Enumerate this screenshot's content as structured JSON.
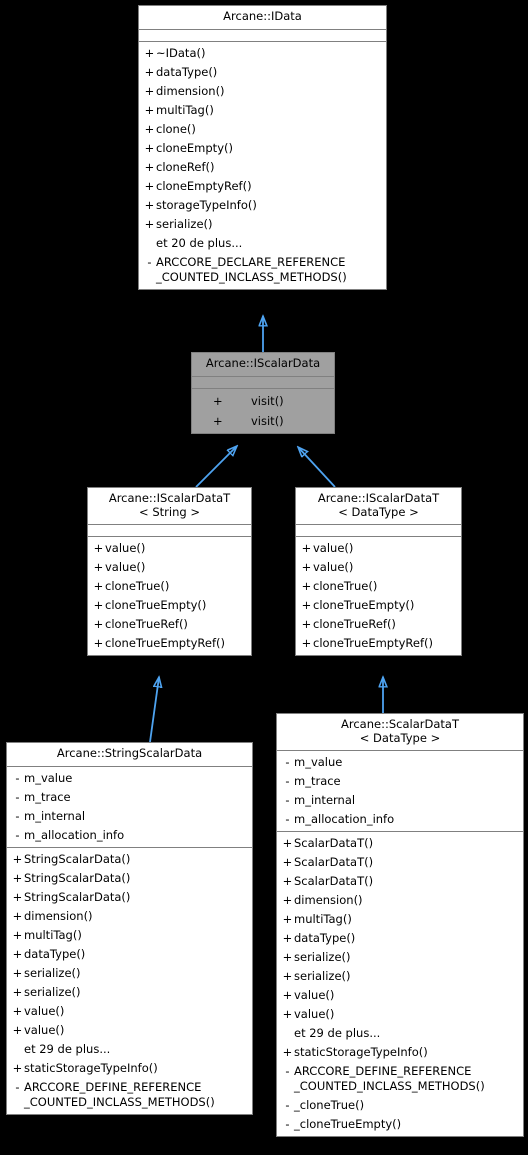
{
  "diagram": {
    "type": "uml-class-inheritance",
    "background_color": "#000000",
    "box_fill": "#ffffff",
    "box_border": "#808080",
    "highlight_fill": "#a0a0a0",
    "edge_color": "#4ea3f0",
    "more_label_20": "et 20 de plus...",
    "more_label_29": "et 29 de plus..."
  },
  "nodes": {
    "idata": {
      "title": "Arcane::IData",
      "attributes": [],
      "methods": [
        {
          "vis": "+",
          "name": "~IData()"
        },
        {
          "vis": "+",
          "name": "dataType()"
        },
        {
          "vis": "+",
          "name": "dimension()"
        },
        {
          "vis": "+",
          "name": "multiTag()"
        },
        {
          "vis": "+",
          "name": "clone()"
        },
        {
          "vis": "+",
          "name": "cloneEmpty()"
        },
        {
          "vis": "+",
          "name": "cloneRef()"
        },
        {
          "vis": "+",
          "name": "cloneEmptyRef()"
        },
        {
          "vis": "+",
          "name": "storageTypeInfo()"
        },
        {
          "vis": "+",
          "name": "serialize()"
        },
        {
          "vis": "",
          "name": "et 20 de plus..."
        },
        {
          "vis": "-",
          "name": "ARCCORE_DECLARE_REFERENCE\n_COUNTED_INCLASS_METHODS()"
        }
      ]
    },
    "iscalardata": {
      "title": "Arcane::IScalarData",
      "attributes": [],
      "methods": [
        {
          "vis": "+",
          "name": "visit()"
        },
        {
          "vis": "+",
          "name": "visit()"
        }
      ]
    },
    "iscalardatat_string": {
      "title": "Arcane::IScalarDataT\n< String >",
      "attributes": [],
      "methods": [
        {
          "vis": "+",
          "name": "value()"
        },
        {
          "vis": "+",
          "name": "value()"
        },
        {
          "vis": "+",
          "name": "cloneTrue()"
        },
        {
          "vis": "+",
          "name": "cloneTrueEmpty()"
        },
        {
          "vis": "+",
          "name": "cloneTrueRef()"
        },
        {
          "vis": "+",
          "name": "cloneTrueEmptyRef()"
        }
      ]
    },
    "iscalardatat_datatype": {
      "title": "Arcane::IScalarDataT\n< DataType >",
      "attributes": [],
      "methods": [
        {
          "vis": "+",
          "name": "value()"
        },
        {
          "vis": "+",
          "name": "value()"
        },
        {
          "vis": "+",
          "name": "cloneTrue()"
        },
        {
          "vis": "+",
          "name": "cloneTrueEmpty()"
        },
        {
          "vis": "+",
          "name": "cloneTrueRef()"
        },
        {
          "vis": "+",
          "name": "cloneTrueEmptyRef()"
        }
      ]
    },
    "stringscalardata": {
      "title": "Arcane::StringScalarData",
      "attributes": [
        {
          "vis": "-",
          "name": "m_value"
        },
        {
          "vis": "-",
          "name": "m_trace"
        },
        {
          "vis": "-",
          "name": "m_internal"
        },
        {
          "vis": "-",
          "name": "m_allocation_info"
        }
      ],
      "methods": [
        {
          "vis": "+",
          "name": "StringScalarData()"
        },
        {
          "vis": "+",
          "name": "StringScalarData()"
        },
        {
          "vis": "+",
          "name": "StringScalarData()"
        },
        {
          "vis": "+",
          "name": "dimension()"
        },
        {
          "vis": "+",
          "name": "multiTag()"
        },
        {
          "vis": "+",
          "name": "dataType()"
        },
        {
          "vis": "+",
          "name": "serialize()"
        },
        {
          "vis": "+",
          "name": "serialize()"
        },
        {
          "vis": "+",
          "name": "value()"
        },
        {
          "vis": "+",
          "name": "value()"
        },
        {
          "vis": "",
          "name": "et 29 de plus..."
        },
        {
          "vis": "+",
          "name": "staticStorageTypeInfo()"
        },
        {
          "vis": "-",
          "name": "ARCCORE_DEFINE_REFERENCE\n_COUNTED_INCLASS_METHODS()"
        }
      ]
    },
    "scalardatat": {
      "title": "Arcane::ScalarDataT\n< DataType >",
      "attributes": [
        {
          "vis": "-",
          "name": "m_value"
        },
        {
          "vis": "-",
          "name": "m_trace"
        },
        {
          "vis": "-",
          "name": "m_internal"
        },
        {
          "vis": "-",
          "name": "m_allocation_info"
        }
      ],
      "methods": [
        {
          "vis": "+",
          "name": "ScalarDataT()"
        },
        {
          "vis": "+",
          "name": "ScalarDataT()"
        },
        {
          "vis": "+",
          "name": "ScalarDataT()"
        },
        {
          "vis": "+",
          "name": "dimension()"
        },
        {
          "vis": "+",
          "name": "multiTag()"
        },
        {
          "vis": "+",
          "name": "dataType()"
        },
        {
          "vis": "+",
          "name": "serialize()"
        },
        {
          "vis": "+",
          "name": "serialize()"
        },
        {
          "vis": "+",
          "name": "value()"
        },
        {
          "vis": "+",
          "name": "value()"
        },
        {
          "vis": "",
          "name": "et 29 de plus..."
        },
        {
          "vis": "+",
          "name": "staticStorageTypeInfo()"
        },
        {
          "vis": "-",
          "name": "ARCCORE_DEFINE_REFERENCE\n_COUNTED_INCLASS_METHODS()"
        },
        {
          "vis": "-",
          "name": "_cloneTrue()"
        },
        {
          "vis": "-",
          "name": "_cloneTrueEmpty()"
        }
      ]
    }
  },
  "edges": [
    {
      "from": "iscalardata",
      "to": "idata",
      "kind": "inheritance"
    },
    {
      "from": "iscalardatat_string",
      "to": "iscalardata",
      "kind": "inheritance"
    },
    {
      "from": "iscalardatat_datatype",
      "to": "iscalardata",
      "kind": "inheritance"
    },
    {
      "from": "stringscalardata",
      "to": "iscalardatat_string",
      "kind": "inheritance"
    },
    {
      "from": "scalardatat",
      "to": "iscalardatat_datatype",
      "kind": "inheritance"
    }
  ]
}
